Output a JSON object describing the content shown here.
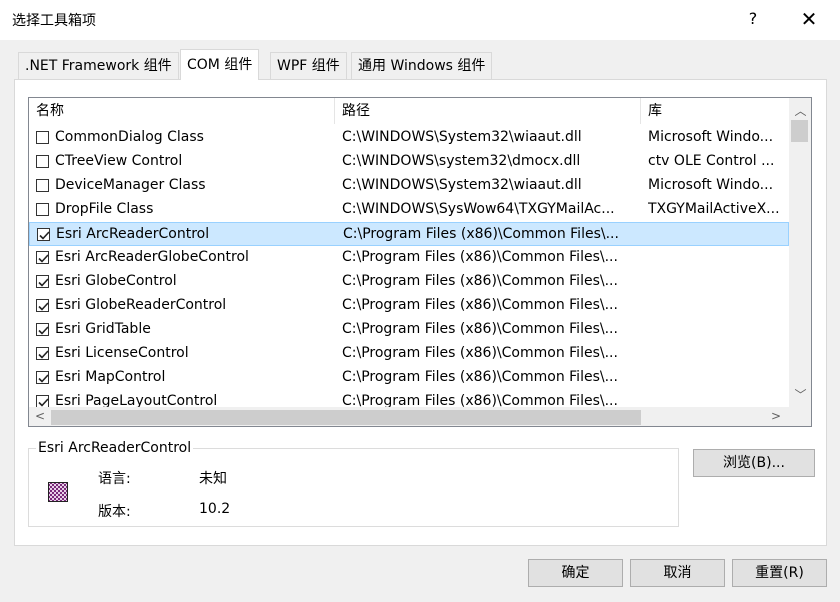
{
  "window": {
    "title": "选择工具箱项",
    "help_glyph": "?",
    "close_glyph": "✕"
  },
  "tabs": [
    {
      "label": ".NET Framework 组件",
      "active": false
    },
    {
      "label": "COM 组件",
      "active": true
    },
    {
      "label": "WPF 组件",
      "active": false
    },
    {
      "label": "通用 Windows 组件",
      "active": false
    }
  ],
  "list": {
    "columns": [
      "名称",
      "路径",
      "库"
    ],
    "rows": [
      {
        "checked": false,
        "selected": false,
        "name": "CommonDialog Class",
        "path": "C:\\WINDOWS\\System32\\wiaaut.dll",
        "library": "Microsoft Windo..."
      },
      {
        "checked": false,
        "selected": false,
        "name": "CTreeView Control",
        "path": "C:\\WINDOWS\\system32\\dmocx.dll",
        "library": "ctv OLE Control ..."
      },
      {
        "checked": false,
        "selected": false,
        "name": "DeviceManager Class",
        "path": "C:\\WINDOWS\\System32\\wiaaut.dll",
        "library": "Microsoft Windo..."
      },
      {
        "checked": false,
        "selected": false,
        "name": "DropFile Class",
        "path": "C:\\WINDOWS\\SysWow64\\TXGYMailAc...",
        "library": "TXGYMailActiveX..."
      },
      {
        "checked": true,
        "selected": true,
        "name": "Esri ArcReaderControl",
        "path": "C:\\Program Files (x86)\\Common Files\\...",
        "library": ""
      },
      {
        "checked": true,
        "selected": false,
        "name": "Esri ArcReaderGlobeControl",
        "path": "C:\\Program Files (x86)\\Common Files\\...",
        "library": ""
      },
      {
        "checked": true,
        "selected": false,
        "name": "Esri GlobeControl",
        "path": "C:\\Program Files (x86)\\Common Files\\...",
        "library": ""
      },
      {
        "checked": true,
        "selected": false,
        "name": "Esri GlobeReaderControl",
        "path": "C:\\Program Files (x86)\\Common Files\\...",
        "library": ""
      },
      {
        "checked": true,
        "selected": false,
        "name": "Esri GridTable",
        "path": "C:\\Program Files (x86)\\Common Files\\...",
        "library": ""
      },
      {
        "checked": true,
        "selected": false,
        "name": "Esri LicenseControl",
        "path": "C:\\Program Files (x86)\\Common Files\\...",
        "library": ""
      },
      {
        "checked": true,
        "selected": false,
        "name": "Esri MapControl",
        "path": "C:\\Program Files (x86)\\Common Files\\...",
        "library": ""
      },
      {
        "checked": true,
        "selected": false,
        "name": "Esri PageLayoutControl",
        "path": "C:\\Program Files (x86)\\Common Files\\...",
        "library": ""
      }
    ]
  },
  "details": {
    "title": "Esri ArcReaderControl",
    "icon": "checkered-control-icon",
    "language_label": "语言:",
    "language_value": "未知",
    "version_label": "版本:",
    "version_value": "10.2"
  },
  "buttons": {
    "browse": "浏览(B)...",
    "ok": "确定",
    "cancel": "取消",
    "reset": "重置(R)"
  },
  "colors": {
    "selection_bg": "#cce8ff",
    "selection_border": "#99d1ff",
    "dialog_bg": "#f0f0f0"
  }
}
